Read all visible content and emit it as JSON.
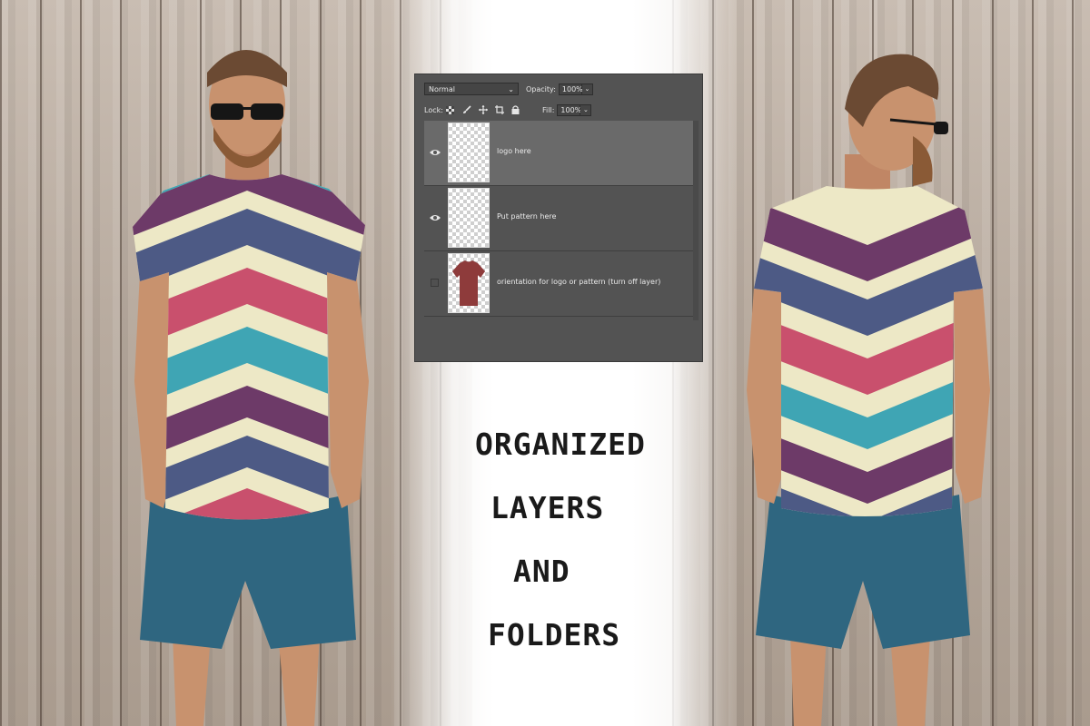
{
  "layers_panel": {
    "blend_mode": "Normal",
    "opacity_label": "Opacity:",
    "opacity_value": "100%",
    "lock_label": "Lock:",
    "fill_label": "Fill:",
    "fill_value": "100%",
    "layers": [
      {
        "name": "logo here",
        "visible": true,
        "selected": true,
        "thumb": "transparent"
      },
      {
        "name": "Put pattern here",
        "visible": true,
        "selected": false,
        "thumb": "transparent"
      },
      {
        "name": "orientation for logo or pattern (turn off layer)",
        "visible": false,
        "selected": false,
        "thumb": "tshirt-silhouette"
      }
    ]
  },
  "headline": {
    "line1": "ORGANIZED",
    "line2": "LAYERS",
    "line3": "AND",
    "line4": "FOLDERS"
  },
  "colors": {
    "panel_bg": "#535353",
    "stripe_cream": "#ede8c6",
    "stripe_blue": "#4d5a85",
    "stripe_red": "#c9506d",
    "stripe_teal": "#3fa5b4",
    "stripe_purple": "#6d3a68",
    "shorts": "#2f6680",
    "thumb_shirt": "#8e3b3b"
  },
  "icons": [
    "eye-icon",
    "checkerboard-lock-icon",
    "brush-lock-icon",
    "move-lock-icon",
    "crop-lock-icon",
    "padlock-icon",
    "chevron-down-icon"
  ]
}
